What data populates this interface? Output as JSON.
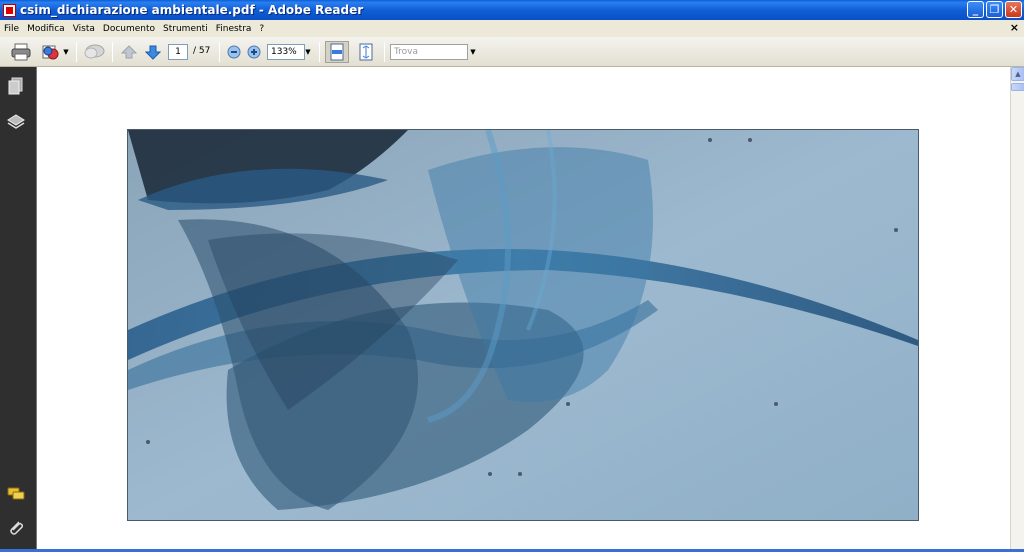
{
  "window": {
    "title": "csim_dichiarazione ambientale.pdf - Adobe Reader",
    "buttons": {
      "minimize": "_",
      "maximize": "❐",
      "close": "✕"
    }
  },
  "menu": {
    "items": [
      "File",
      "Modifica",
      "Vista",
      "Documento",
      "Strumenti",
      "Finestra",
      "?"
    ],
    "close": "×"
  },
  "toolbar": {
    "current_page": "1",
    "page_total": "/ 57",
    "zoom": "133%",
    "find_placeholder": "Trova",
    "dropdown_arrow": "▼"
  },
  "sidebar": {
    "icons": [
      "pages-icon",
      "layers-icon",
      "comments-icon",
      "attachments-icon"
    ]
  },
  "document": {
    "image_description_colors": {
      "background": "#9ab6cc",
      "ribbon": "#2e5f86"
    }
  },
  "scrollbar": {
    "up": "▲"
  },
  "colors": {
    "titlebar": "#0a5fd8",
    "sidebar": "#2f2f2f",
    "accent": "#3a6fd8"
  }
}
